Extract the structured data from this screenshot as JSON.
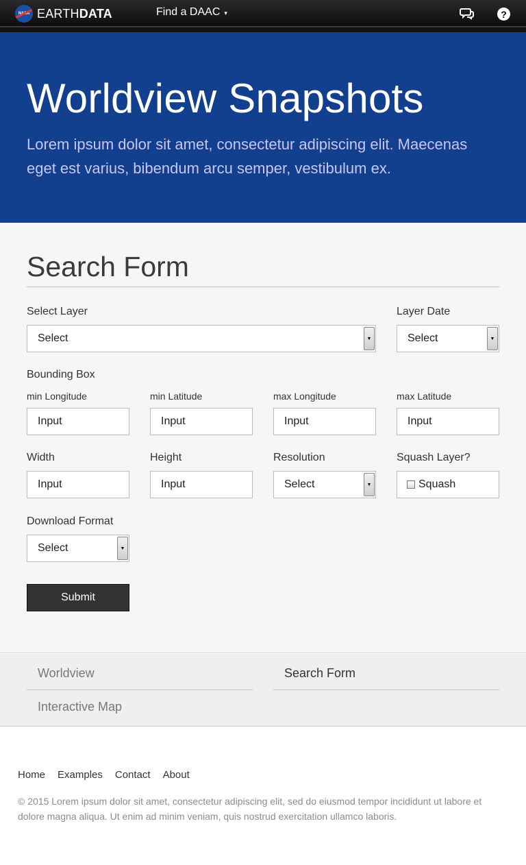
{
  "nav": {
    "brand_light": "EARTH",
    "brand_bold": "DATA",
    "nasa_mark": "NASA",
    "find_daac": "Find a DAAC",
    "find_daac_caret": "▾",
    "help_glyph": "?"
  },
  "hero": {
    "title": "Worldview Snapshots",
    "subtitle": "Lorem ipsum dolor sit amet, consectetur adipiscing elit. Maecenas eget est varius, bibendum arcu semper, vestibulum ex."
  },
  "form": {
    "title": "Search Form",
    "select_layer": {
      "label": "Select Layer",
      "value": "Select"
    },
    "layer_date": {
      "label": "Layer Date",
      "value": "Select"
    },
    "bounding_box": {
      "label": "Bounding Box",
      "min_longitude": {
        "label": "min Longitude",
        "placeholder": "Input"
      },
      "min_latitude": {
        "label": "min Latitude",
        "placeholder": "Input"
      },
      "max_longitude": {
        "label": "max Longitude",
        "placeholder": "Input"
      },
      "max_latitude": {
        "label": "max Latitude",
        "placeholder": "Input"
      }
    },
    "width": {
      "label": "Width",
      "placeholder": "Input"
    },
    "height": {
      "label": "Height",
      "placeholder": "Input"
    },
    "resolution": {
      "label": "Resolution",
      "value": "Select"
    },
    "squash": {
      "label": "Squash Layer?",
      "checkbox_label": "Squash",
      "checked": false
    },
    "download_format": {
      "label": "Download Format",
      "value": "Select"
    },
    "submit_label": "Submit"
  },
  "subnav": {
    "items": [
      {
        "label": "Worldview",
        "active": false
      },
      {
        "label": "Search Form",
        "active": true
      },
      {
        "label": "Interactive Map",
        "active": false
      }
    ]
  },
  "footer": {
    "links": [
      "Home",
      "Examples",
      "Contact",
      "About"
    ],
    "copyright": "© 2015 Lorem ipsum dolor sit amet, consectetur adipiscing elit, sed do eiusmod tempor incididunt ut labore et dolore magna aliqua. Ut enim ad minim veniam, quis nostrud exercitation ullamco laboris."
  },
  "icons": {
    "nasa": "nasa-logo-icon",
    "chat": "chat-icon",
    "help": "help-icon",
    "select_arrow": "dropdown-arrow-icon"
  },
  "colors": {
    "hero_bg": "#133f8f",
    "hero_subtitle": "#c9c6f3",
    "topbar": "#111111",
    "submit_bg": "#333333"
  }
}
